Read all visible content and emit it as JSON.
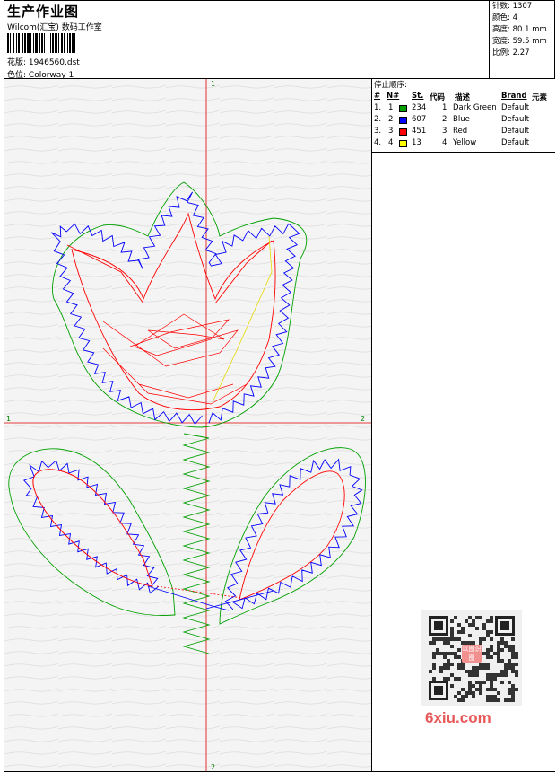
{
  "header": {
    "title": "生产作业图",
    "company": "Wilcom(汇宝) 数码工作室",
    "pattern_label": "花版:",
    "pattern_value": "1946560.dst",
    "colorway_label": "色位:",
    "colorway_value": "Colorway 1"
  },
  "info": {
    "stitches_label": "针数:",
    "stitches_value": "1307",
    "colors_label": "颜色:",
    "colors_value": "4",
    "height_label": "高度:",
    "height_value": "80.1 mm",
    "width_label": "宽度:",
    "width_value": "59.5 mm",
    "ratio_label": "比例:",
    "ratio_value": "2.27"
  },
  "stop_sequence": {
    "title": "停止顺序:",
    "headers": {
      "num": "#",
      "needle": "N#",
      "st": "St.",
      "code": "代码",
      "desc": "描述",
      "brand": "Brand",
      "element": "元素"
    },
    "rows": [
      {
        "num": "1.",
        "needle": "1",
        "color": "#00a000",
        "st": "234",
        "code": "1",
        "desc": "Dark Green",
        "brand": "Default"
      },
      {
        "num": "2.",
        "needle": "2",
        "color": "#0000ff",
        "st": "607",
        "code": "2",
        "desc": "Blue",
        "brand": "Default"
      },
      {
        "num": "3.",
        "needle": "3",
        "color": "#ff0000",
        "st": "451",
        "code": "3",
        "desc": "Red",
        "brand": "Default"
      },
      {
        "num": "4.",
        "needle": "4",
        "color": "#ffff00",
        "st": "13",
        "code": "4",
        "desc": "Yellow",
        "brand": "Default"
      }
    ]
  },
  "axes": {
    "top": "1",
    "bottom": "2",
    "left": "1",
    "right": "2"
  },
  "watermark": {
    "text": "6xiu.com",
    "stamp": "以图识图"
  },
  "colors": {
    "green": "#00a000",
    "blue": "#0000ff",
    "red": "#ff0000",
    "yellow": "#e8d800",
    "axis": "#e00000"
  }
}
